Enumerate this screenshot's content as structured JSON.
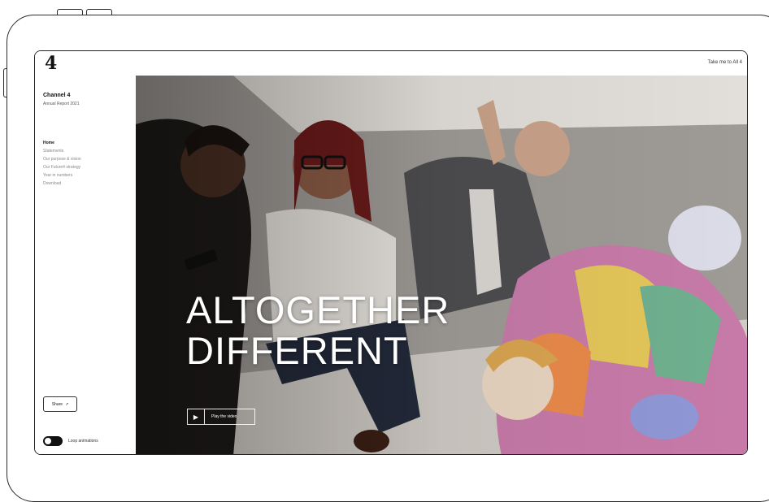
{
  "header": {
    "logo": "4",
    "take_me_link": "Take me to All 4"
  },
  "sidebar": {
    "brand_title": "Channel 4",
    "brand_subtitle": "Annual Report 2021",
    "nav_items": [
      {
        "label": "Home",
        "active": true
      },
      {
        "label": "Statements",
        "active": false
      },
      {
        "label": "Our purpose & vision",
        "active": false
      },
      {
        "label": "Our Future4 strategy",
        "active": false
      },
      {
        "label": "Year in numbers",
        "active": false
      },
      {
        "label": "Download",
        "active": false
      }
    ],
    "share_label": "Share",
    "share_icon": "external-arrow-icon",
    "loop_label": "Loop animations",
    "loop_on": true
  },
  "hero": {
    "headline_line1": "ALTOGETHER",
    "headline_line2": "DIFFERENT",
    "play_label": "Play the video"
  },
  "colors": {
    "frame": "#2a2a2a",
    "text_dark": "#111111",
    "hero_text": "#ffffff"
  }
}
